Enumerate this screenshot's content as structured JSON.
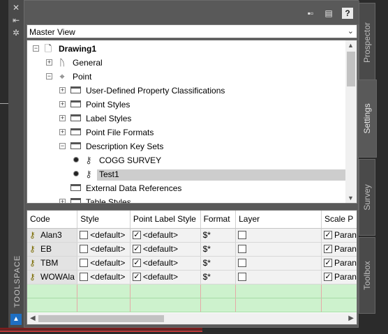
{
  "palette": {
    "title": "TOOLSPACE",
    "close_icon": "close-icon",
    "autohide_icon": "autohide-icon",
    "properties_icon": "properties-icon"
  },
  "toolbar": {
    "icons": [
      "tree-view-icon",
      "item-view-icon",
      "help-icon"
    ],
    "help_glyph": "?"
  },
  "view_select": {
    "value": "Master View"
  },
  "tree": {
    "items": [
      {
        "label": "Drawing1",
        "bold": true
      },
      {
        "label": "General"
      },
      {
        "label": "Point"
      },
      {
        "label": "User-Defined Property Classifications"
      },
      {
        "label": "Point Styles"
      },
      {
        "label": "Label Styles"
      },
      {
        "label": "Point File Formats"
      },
      {
        "label": "Description Key Sets"
      },
      {
        "label": "COGG SURVEY"
      },
      {
        "label": "Test1",
        "selected": true
      },
      {
        "label": "External Data References"
      },
      {
        "label": "Table Styles"
      }
    ]
  },
  "grid": {
    "columns": [
      "Code",
      "Style",
      "Point Label Style",
      "Format",
      "Layer",
      "Scale P"
    ],
    "rows": [
      {
        "code": "Alan3",
        "style": "<default>",
        "label_style": "<default>",
        "format": "$*",
        "scale": "Paran"
      },
      {
        "code": "EB",
        "style": "<default>",
        "label_style": "<default>",
        "format": "$*",
        "scale": "Paran"
      },
      {
        "code": "TBM",
        "style": "<default>",
        "label_style": "<default>",
        "format": "$*",
        "scale": "Paran"
      },
      {
        "code": "WOWAla",
        "style": "<default>",
        "label_style": "<default>",
        "format": "$*",
        "scale": "Paran"
      }
    ]
  },
  "tabs": [
    "Prospector",
    "Settings",
    "Survey",
    "Toolbox"
  ],
  "active_tab": "Settings"
}
